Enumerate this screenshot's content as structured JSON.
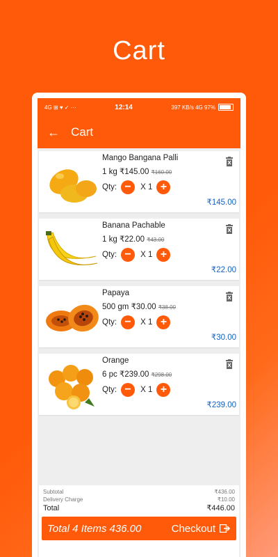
{
  "promo": {
    "title": "Cart"
  },
  "status_bar": {
    "left_icons": "4G ⊞ ♥ ✓ ··· ",
    "time": "12:14",
    "right_info": "397 KB/s 4G 97%"
  },
  "app_bar": {
    "back_icon": "arrow-left-icon",
    "title": "Cart"
  },
  "items": [
    {
      "name": "Mango Bangana Palli",
      "unit": "1 kg",
      "price": "₹145.00",
      "mrp": "₹160.00",
      "qty_label": "Qty:",
      "qty_value": "X 1",
      "line_total": "₹145.00",
      "image": "mango"
    },
    {
      "name": "Banana Pachable",
      "unit": "1 kg",
      "price": "₹22.00",
      "mrp": "₹43.00",
      "qty_label": "Qty:",
      "qty_value": "X 1",
      "line_total": "₹22.00",
      "image": "banana"
    },
    {
      "name": "Papaya",
      "unit": "500 gm",
      "price": "₹30.00",
      "mrp": "₹38.00",
      "qty_label": "Qty:",
      "qty_value": "X 1",
      "line_total": "₹30.00",
      "image": "papaya"
    },
    {
      "name": "Orange",
      "unit": "6 pc",
      "price": "₹239.00",
      "mrp": "₹298.00",
      "qty_label": "Qty:",
      "qty_value": "X 1",
      "line_total": "₹239.00",
      "image": "orange"
    }
  ],
  "summary": {
    "subtotal_label": "Subtotal",
    "subtotal_value": "₹436.00",
    "delivery_label": "Delivery Charge",
    "delivery_value": "₹10.00",
    "total_label": "Total",
    "total_value": "₹446.00"
  },
  "checkout_bar": {
    "items_text": "Total 4 Items 436.00",
    "checkout_label": "Checkout"
  },
  "colors": {
    "primary": "#ff5a0a",
    "price_blue": "#1560bd"
  }
}
